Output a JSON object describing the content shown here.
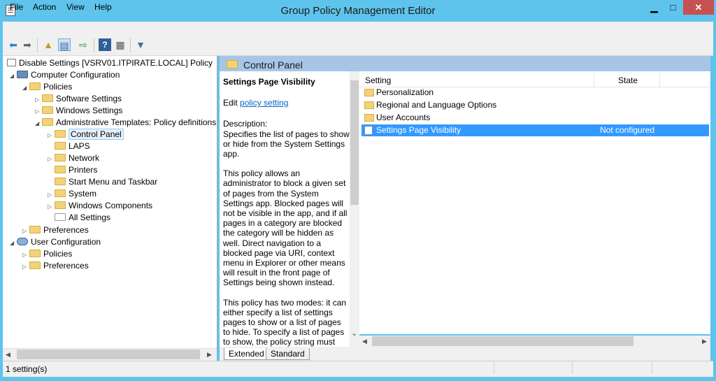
{
  "window": {
    "title": "Group Policy Management Editor",
    "minimize": "▁",
    "maximize": "□",
    "close": "✕"
  },
  "menu": [
    "File",
    "Action",
    "View",
    "Help"
  ],
  "toolbar": {
    "icons": [
      "back-icon",
      "forward-icon",
      "up-folder-icon",
      "show-hide-tree-icon",
      "export-list-icon",
      "help-icon",
      "properties-icon",
      "filter-icon"
    ]
  },
  "tree": {
    "root": "Disable Settings [VSRV01.ITPIRATE.LOCAL] Policy",
    "computer_configuration": "Computer Configuration",
    "policies": "Policies",
    "software_settings": "Software Settings",
    "windows_settings": "Windows Settings",
    "admin_templates": "Administrative Templates: Policy definitions",
    "control_panel": "Control Panel",
    "laps": "LAPS",
    "network": "Network",
    "printers": "Printers",
    "start_menu": "Start Menu and Taskbar",
    "system": "System",
    "windows_components": "Windows Components",
    "all_settings": "All Settings",
    "preferences": "Preferences",
    "user_configuration": "User Configuration",
    "user_policies": "Policies",
    "user_preferences": "Preferences"
  },
  "pane": {
    "header": "Control Panel",
    "policy_title": "Settings Page Visibility",
    "edit_prefix": "Edit ",
    "edit_link": "policy setting",
    "description_label": "Description:",
    "description_1": "Specifies the list of pages to show or hide from the System Settings app.",
    "description_2": "This policy allows an administrator to block a given set of pages from the System Settings app. Blocked pages will not be visible in the app, and if all pages in a category are blocked the category will be hidden as well. Direct navigation to a blocked page via URI, context menu in Explorer or other means will result in the front page of Settings being shown instead.",
    "description_3": "This policy has two modes: it can either specify a list of settings pages to show or a list of pages to hide. To specify a list of pages to show, the policy string must begin"
  },
  "list": {
    "col_setting": "Setting",
    "col_state": "State",
    "rows": [
      {
        "label": "Personalization",
        "state": ""
      },
      {
        "label": "Regional and Language Options",
        "state": ""
      },
      {
        "label": "User Accounts",
        "state": ""
      },
      {
        "label": "Settings Page Visibility",
        "state": "Not configured"
      }
    ]
  },
  "tabs": [
    "Extended",
    "Standard"
  ],
  "status": {
    "text": "1 setting(s)"
  },
  "colors": {
    "titlebar": "#5ec4ec",
    "selection": "#3399ff",
    "header_band": "#a7c6e6",
    "close": "#c75050"
  }
}
